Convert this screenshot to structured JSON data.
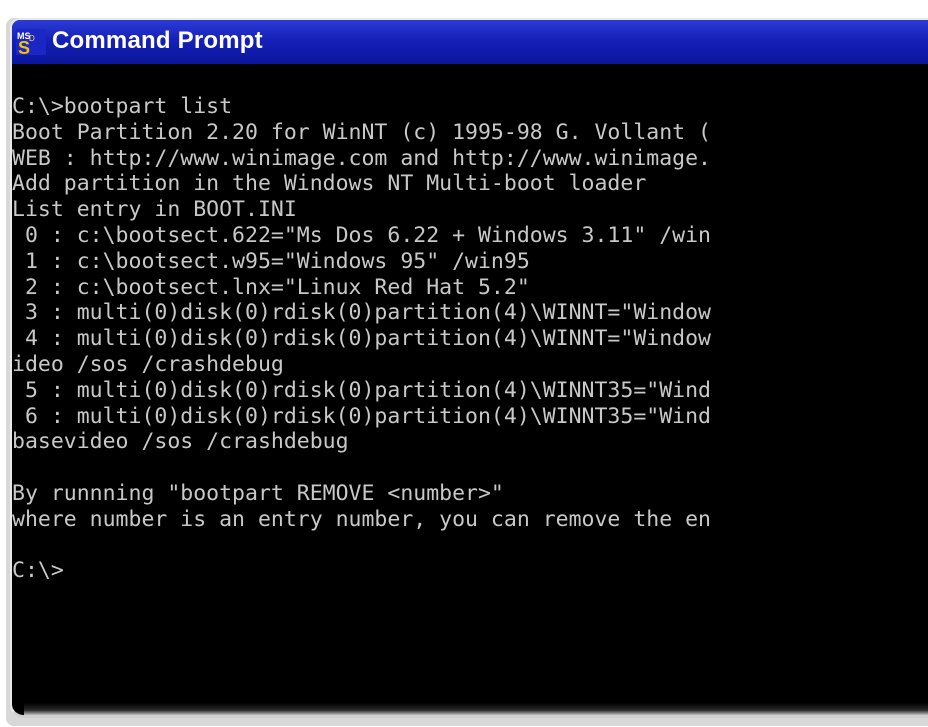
{
  "window": {
    "title": "Command Prompt",
    "icon": "command-prompt-icon"
  },
  "console": {
    "lines": [
      "C:\\>bootpart list",
      "Boot Partition 2.20 for WinNT (c) 1995-98 G. Vollant (",
      "WEB : http://www.winimage.com and http://www.winimage.",
      "Add partition in the Windows NT Multi-boot loader",
      "List entry in BOOT.INI",
      " 0 : c:\\bootsect.622=\"Ms Dos 6.22 + Windows 3.11\" /win",
      " 1 : c:\\bootsect.w95=\"Windows 95\" /win95",
      " 2 : c:\\bootsect.lnx=\"Linux Red Hat 5.2\"",
      " 3 : multi(0)disk(0)rdisk(0)partition(4)\\WINNT=\"Window",
      " 4 : multi(0)disk(0)rdisk(0)partition(4)\\WINNT=\"Window",
      "ideo /sos /crashdebug",
      " 5 : multi(0)disk(0)rdisk(0)partition(4)\\WINNT35=\"Wind",
      " 6 : multi(0)disk(0)rdisk(0)partition(4)\\WINNT35=\"Wind",
      "basevideo /sos /crashdebug",
      "",
      "By runnning \"bootpart REMOVE <number>\"",
      "where number is an entry number, you can remove the en",
      "",
      "C:\\>"
    ]
  },
  "colors": {
    "titlebar": "#1420b8",
    "console_bg": "#000000",
    "console_text": "#c8c8c8",
    "title_text": "#ffffff"
  }
}
